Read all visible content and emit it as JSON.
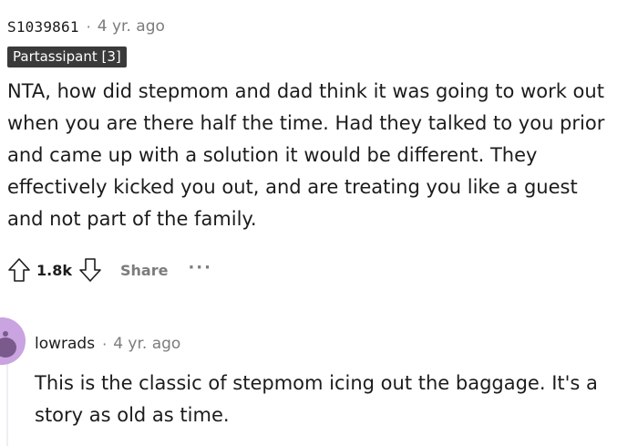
{
  "comment": {
    "username": "S1039861",
    "separator": "·",
    "time": "4 yr. ago",
    "flair": "Partassipant [3]",
    "body": "NTA, how did stepmom and dad think it was going to work out when you are there half the time. Had they talked to you prior and came up with a solution it would be different. They effectively kicked you out, and are treating you like a guest and not part of the family.",
    "score": "1.8k",
    "share_label": "Share",
    "more_label": "···",
    "icons": {
      "upvote": "upvote-arrow-icon",
      "downvote": "downvote-arrow-icon",
      "more": "more-options-icon"
    }
  },
  "reply": {
    "username": "lowrads",
    "separator": "·",
    "time": "4 yr. ago",
    "body": "This is the classic of stepmom icing out the baggage. It's a story as old as time.",
    "avatar_icon": "user-avatar-icon"
  },
  "colors": {
    "text": "#1c1c1c",
    "muted": "#7c7c7c",
    "flair_bg": "#3a3a3a",
    "avatar_bg": "#c9a4e0"
  }
}
